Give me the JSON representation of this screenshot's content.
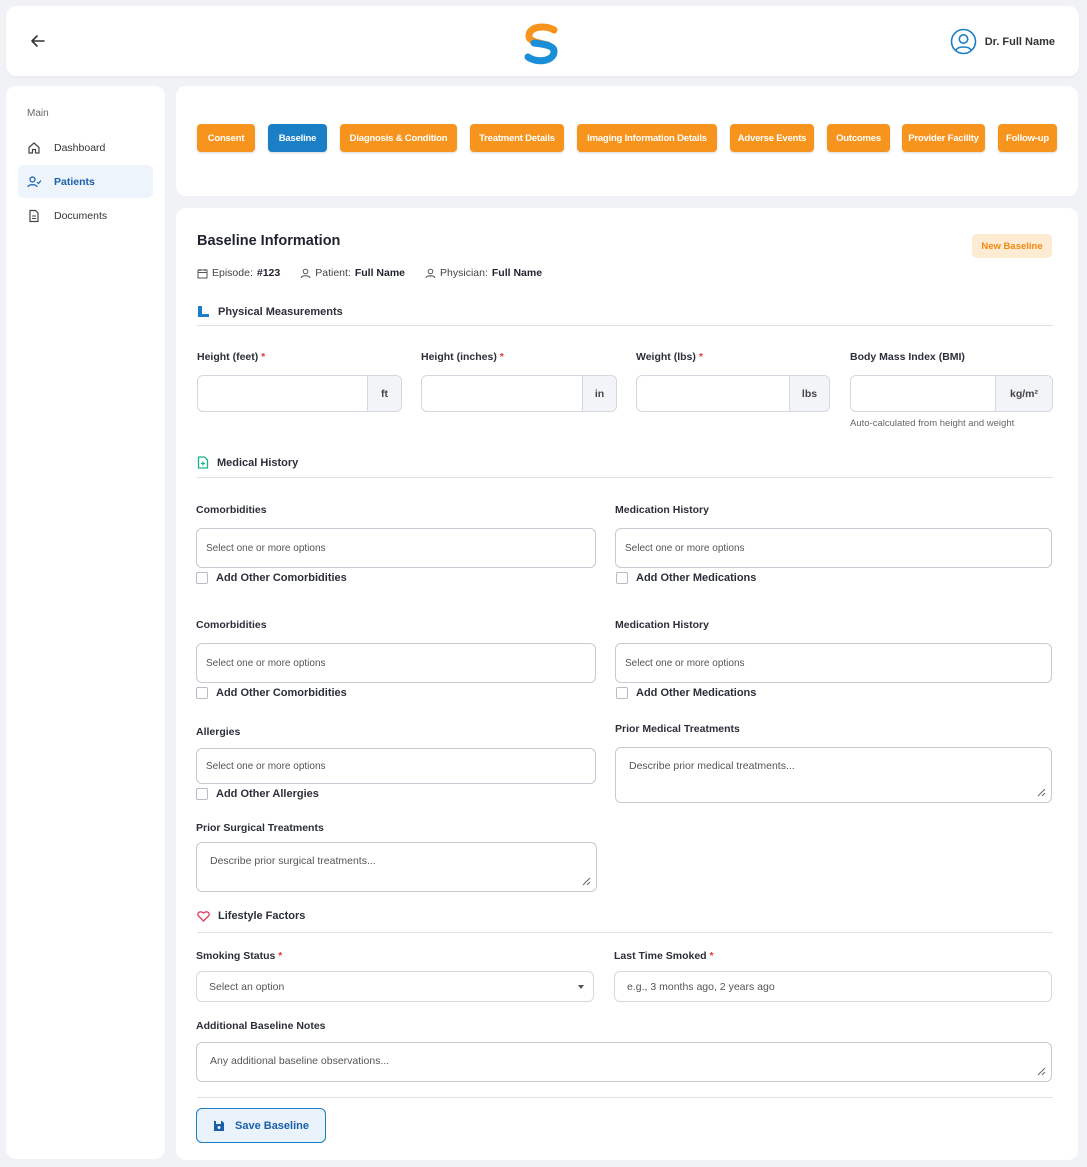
{
  "header": {
    "user_name": "Dr. Full Name"
  },
  "sidebar": {
    "section": "Main",
    "items": [
      {
        "label": "Dashboard",
        "icon": "home-icon"
      },
      {
        "label": "Patients",
        "icon": "users-icon",
        "active": true
      },
      {
        "label": "Documents",
        "icon": "document-icon"
      }
    ]
  },
  "tabs": [
    "Consent",
    "Baseline",
    "Diagnosis & Condition",
    "Treatment Details",
    "Imaging Information Details",
    "Adverse Events",
    "Outcomes",
    "Provider Facility",
    "Follow-up"
  ],
  "active_tab": "Baseline",
  "page": {
    "title": "Baseline Information",
    "badge": "New Baseline",
    "episode_label": "Episode:",
    "episode_value": "#123",
    "patient_label": "Patient:",
    "patient_value": "Full Name",
    "physician_label": "Physician:",
    "physician_value": "Full Name"
  },
  "physical": {
    "heading": "Physical Measurements",
    "height_feet_label": "Height (feet)",
    "height_feet_unit": "ft",
    "height_inches_label": "Height (inches)",
    "height_inches_unit": "in",
    "weight_label": "Weight (lbs)",
    "weight_unit": "lbs",
    "bmi_label": "Body Mass Index (BMI)",
    "bmi_unit": "kg/m²",
    "bmi_hint": "Auto-calculated from height and weight"
  },
  "medical": {
    "heading": "Medical History",
    "comorbidities_label": "Comorbidities",
    "medication_label": "Medication History",
    "select_placeholder": "Select one or more options",
    "add_comorbidities": "Add Other Comorbidities",
    "add_medications": "Add Other Medications",
    "allergies_label": "Allergies",
    "add_allergies": "Add Other Allergies",
    "prior_medical_label": "Prior Medical Treatments",
    "prior_medical_placeholder": "Describe prior medical treatments...",
    "prior_surgical_label": "Prior Surgical Treatments",
    "prior_surgical_placeholder": "Describe prior surgical treatments..."
  },
  "lifestyle": {
    "heading": "Lifestyle Factors",
    "smoking_label": "Smoking Status",
    "smoking_placeholder": "Select an option",
    "last_smoked_label": "Last Time Smoked",
    "last_smoked_placeholder": "e.g., 3 months ago, 2 years ago",
    "notes_label": "Additional Baseline Notes",
    "notes_placeholder": "Any additional baseline observations..."
  },
  "save_label": "Save Baseline",
  "colors": {
    "orange": "#f7941d",
    "blue": "#1a7fc4",
    "badge_bg": "#fdebd3"
  }
}
